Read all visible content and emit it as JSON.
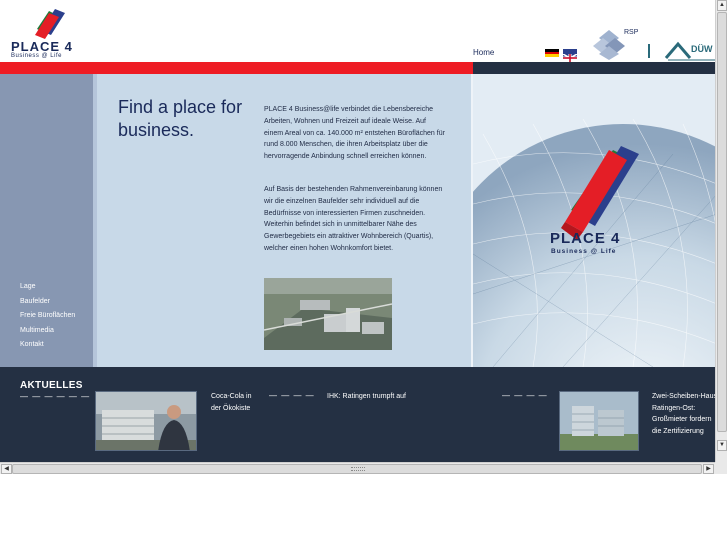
{
  "header": {
    "logo_text": "PLACE 4",
    "logo_subtext": "Business @ Life",
    "home_link": "Home",
    "rsp_label": "RSP",
    "duw_label": "DÜW"
  },
  "nav": {
    "items": [
      "Lage",
      "Baufelder",
      "Freie Büroflächen",
      "Multimedia",
      "Kontakt"
    ]
  },
  "main": {
    "headline": "Find a place for business.",
    "paragraph1": "PLACE 4 Business@life verbindet die Lebensbereiche Arbeiten, Wohnen und Freizeit auf ideale Weise. Auf einem Areal von ca. 140.000 m² entstehen Büroflächen für rund 8.000 Menschen, die ihren Arbeitsplatz über die hervorragende Anbindung schnell erreichen können.",
    "paragraph2": "Auf Basis der bestehenden Rahmenvereinbarung können wir die einzelnen Baufelder sehr individuell auf die Bedürfnisse von interessierten Firmen zuschneiden. Weiterhin befindet sich in unmittelbarer Nähe des Gewerbegebiets ein attraktiver Wohnbereich (Quartis), welcher einen hohen Wohnkomfort bietet."
  },
  "globe": {
    "logo_text": "PLACE 4",
    "logo_subtext": "Business @ Life"
  },
  "news": {
    "title": "AKTUELLES",
    "dashes": "— — — — — —",
    "dashes_short": "— — — —",
    "item1": "Coca-Cola in der Ökokiste",
    "item2": "IHK: Ratingen trumpft auf",
    "item3": "Zwei-Scheiben-Haus Ratingen-Ost: Großmieter fordern die Zertifizierung"
  },
  "colors": {
    "red_bar": "#ee1c24",
    "navy": "#243043",
    "nav_blue": "#8797b2",
    "content_blue": "#c8d9e8"
  }
}
